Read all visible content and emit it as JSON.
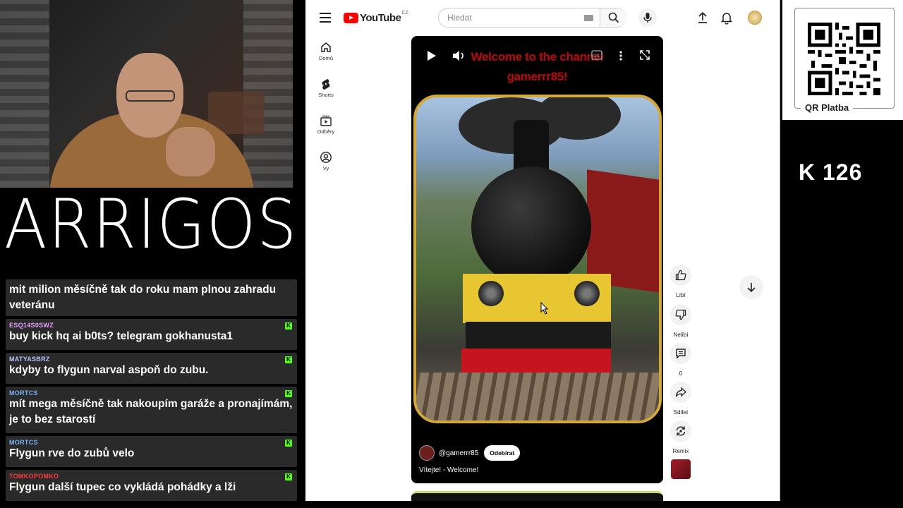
{
  "stream": {
    "logo_text": "ARRIGOS",
    "counter": "K  126"
  },
  "qr": {
    "label": "QR Platba"
  },
  "chat": {
    "messages": [
      {
        "user": "",
        "text": "mit milion měsíčně tak do roku mam plnou zahradu veteránu",
        "user_color": "#7ab2ff"
      },
      {
        "user": "ESQ14S0SWZ",
        "text": "buy kick hq ai b0ts? telegram gokhanusta1",
        "user_color": "#e8a0ff"
      },
      {
        "user": "MATYASBRZ",
        "text": "kdyby to flygun narval aspoň do zubu.",
        "user_color": "#b9c7ff"
      },
      {
        "user": "MORTCS",
        "text": "mít mega měsíčně tak nakoupím garáže a pronajímám, je to bez starostí",
        "user_color": "#7ab2ff"
      },
      {
        "user": "MORTCS",
        "text": "Flygun rve do zubů velo",
        "user_color": "#7ab2ff"
      },
      {
        "user": "TOMKOPOMKO",
        "text": "Flygun další tupec co vykládá pohádky a lži",
        "user_color": "#ff3b3b"
      }
    ],
    "badge": "K"
  },
  "youtube": {
    "logo_word": "YouTube",
    "region": "CZ",
    "search_placeholder": "Hledat",
    "nav": [
      {
        "label": "Domů",
        "icon": "home-icon"
      },
      {
        "label": "Shorts",
        "icon": "shorts-icon"
      },
      {
        "label": "Odběry",
        "icon": "subscriptions-icon"
      },
      {
        "label": "Vy",
        "icon": "you-icon"
      }
    ],
    "short": {
      "overlay_title_line1": "Welcome to the channel",
      "overlay_title_line2": "gamerrr85!",
      "channel": "@gamerrr85",
      "subscribe_label": "Odebírat",
      "description": "Vítejte! - Welcome!"
    },
    "actions": [
      {
        "label": "Líbí",
        "icon": "like-icon"
      },
      {
        "label": "Nelíbí",
        "icon": "dislike-icon"
      },
      {
        "label": "0",
        "icon": "comment-icon"
      },
      {
        "label": "Sdílet",
        "icon": "share-icon"
      },
      {
        "label": "Remix",
        "icon": "remix-icon"
      }
    ]
  }
}
